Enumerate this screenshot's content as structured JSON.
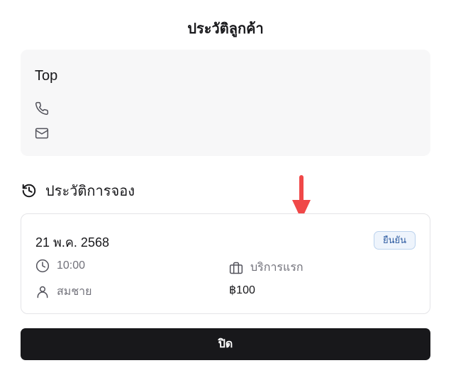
{
  "dialog": {
    "title": "ประวัติลูกค้า",
    "close_label": "ปิด"
  },
  "customer": {
    "name": "Top",
    "phone": "",
    "email": ""
  },
  "history": {
    "title": "ประวัติการจอง",
    "bookings": [
      {
        "date": "21 พ.ค. 2568",
        "status": "ยืนยัน",
        "time": "10:00",
        "service": "บริการแรก",
        "staff": "สมชาย",
        "price": "฿100"
      }
    ]
  },
  "colors": {
    "primary_button": "#18181b",
    "status_badge_bg": "#eef4fc",
    "status_badge_text": "#2c5aa0",
    "annotation_arrow": "#f04848"
  },
  "icons": [
    "phone-icon",
    "mail-icon",
    "history-icon",
    "clock-icon",
    "briefcase-icon",
    "user-icon",
    "arrow-down-icon"
  ]
}
